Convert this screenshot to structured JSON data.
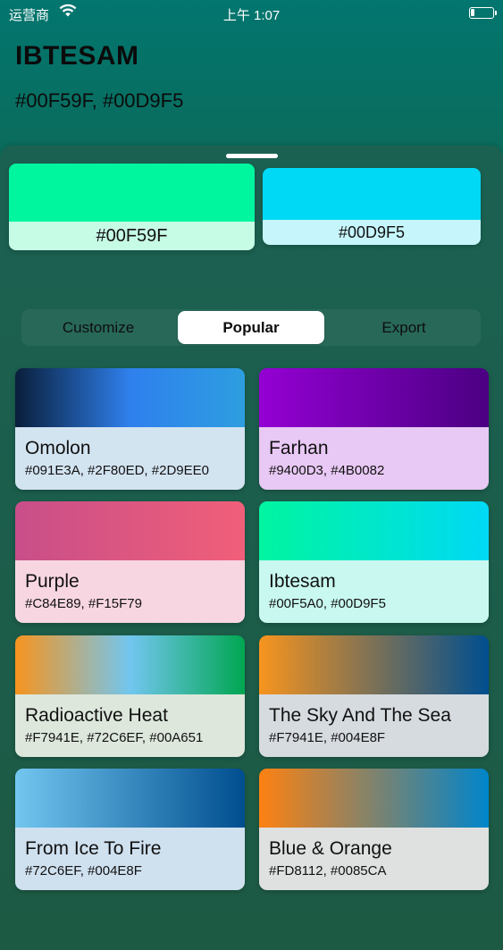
{
  "status": {
    "carrier": "运营商",
    "time": "上午 1:07"
  },
  "header": {
    "title": "IBTESAM",
    "subtitle": "#00F59F, #00D9F5"
  },
  "selected": {
    "colors": [
      {
        "hex": "#00F59F"
      },
      {
        "hex": "#00D9F5"
      }
    ]
  },
  "tabs": [
    {
      "label": "Customize"
    },
    {
      "label": "Popular",
      "active": true
    },
    {
      "label": "Export"
    }
  ],
  "gradients": [
    {
      "name": "Omolon",
      "hex_text": "#091E3A, #2F80ED, #2D9EE0",
      "colors": [
        "#091E3A",
        "#2F80ED",
        "#2D9EE0"
      ],
      "info_bg": "#d3e4f1"
    },
    {
      "name": "Farhan",
      "hex_text": "#9400D3, #4B0082",
      "colors": [
        "#9400D3",
        "#4B0082"
      ],
      "info_bg": "#e8c8f4"
    },
    {
      "name": "Purple",
      "hex_text": "#C84E89, #F15F79",
      "colors": [
        "#C84E89",
        "#F15F79"
      ],
      "info_bg": "#f7d6e2"
    },
    {
      "name": "Ibtesam",
      "hex_text": "#00F5A0, #00D9F5",
      "colors": [
        "#00F5A0",
        "#00D9F5"
      ],
      "info_bg": "#c8f8ef"
    },
    {
      "name": "Radioactive Heat",
      "hex_text": "#F7941E, #72C6EF, #00A651",
      "colors": [
        "#F7941E",
        "#72C6EF",
        "#00A651"
      ],
      "info_bg": "#dde7dc"
    },
    {
      "name": "The Sky And The Sea",
      "hex_text": "#F7941E, #004E8F",
      "colors": [
        "#F7941E",
        "#004E8F"
      ],
      "info_bg": "#d6dbe0"
    },
    {
      "name": "From Ice To Fire",
      "hex_text": "#72C6EF, #004E8F",
      "colors": [
        "#72C6EF",
        "#004E8F"
      ],
      "info_bg": "#cfe0ef"
    },
    {
      "name": "Blue & Orange",
      "hex_text": "#FD8112, #0085CA",
      "colors": [
        "#FD8112",
        "#0085CA"
      ],
      "info_bg": "#dfe0e0"
    }
  ]
}
